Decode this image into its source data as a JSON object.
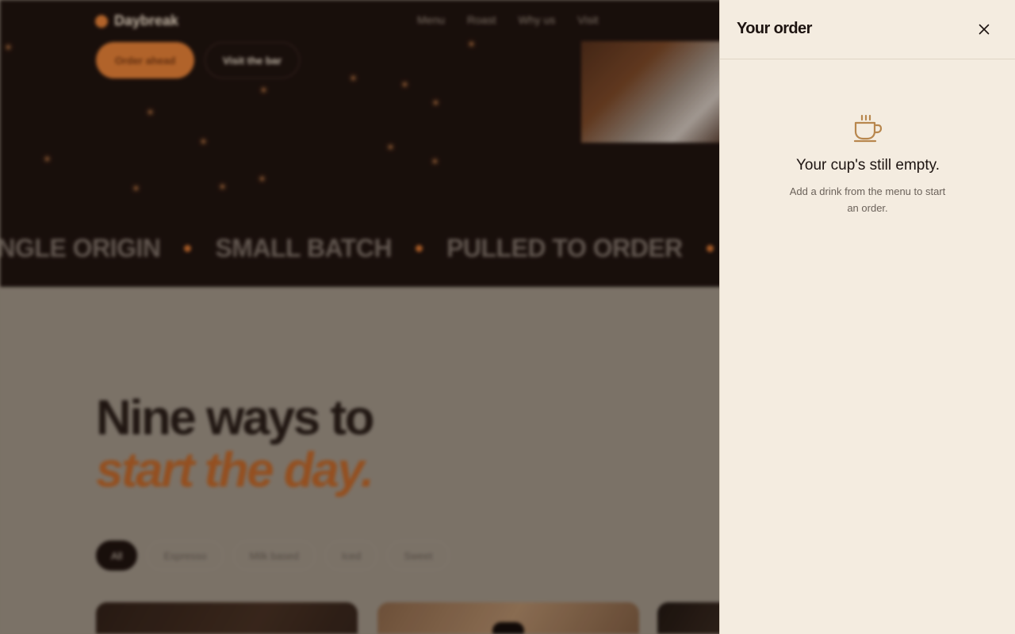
{
  "site": {
    "brand": "Daybreak",
    "nav_links": [
      "Menu",
      "Roast",
      "Why us",
      "Visit"
    ],
    "hero_buttons": {
      "order": "Order ahead",
      "bar": "Visit the bar"
    },
    "ticker": [
      "INGLE ORIGIN",
      "SMALL BATCH",
      "PULLED TO ORDER"
    ],
    "headline": "Nine ways to",
    "headline_accent": "start the day.",
    "filters": [
      "All",
      "Espresso",
      "Milk based",
      "Iced",
      "Sweet"
    ],
    "colors": {
      "hero_bg": "#1a100c",
      "accent": "#c8702f",
      "section_bg": "#8a8175"
    }
  },
  "drawer": {
    "title": "Your order",
    "close_icon": "close-icon",
    "empty_icon": "coffee-cup-icon",
    "empty_title": "Your cup's still empty.",
    "empty_subtitle": "Add a drink from the menu to start an order.",
    "colors": {
      "background": "#f4ece0",
      "icon": "#b8874e"
    }
  }
}
